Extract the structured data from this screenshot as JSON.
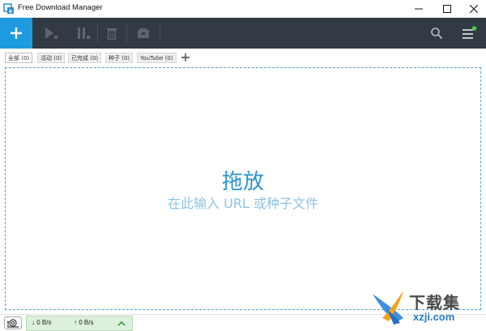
{
  "window": {
    "title": "Free Download Manager"
  },
  "toolbar": {
    "add_icon": "plus-icon",
    "icons": [
      "play-icon",
      "pause-icon",
      "trash-icon",
      "folder-icon",
      "search-icon",
      "menu-icon"
    ],
    "accent": "#1e9be0",
    "background": "#323a44"
  },
  "tabs": [
    {
      "label": "全部 (0)"
    },
    {
      "label": "活动 (0)"
    },
    {
      "label": "已完成 (0)"
    },
    {
      "label": "种子 (0)"
    },
    {
      "label": "YouTube (0)"
    }
  ],
  "dropzone": {
    "title": "拖放",
    "subtitle": "在此输入 URL 或种子文件"
  },
  "status": {
    "download_speed": "↓ 0 B/s",
    "upload_speed": "↑ 0 B/s"
  },
  "watermark": {
    "text": "下载集",
    "url": "xzji.com"
  }
}
